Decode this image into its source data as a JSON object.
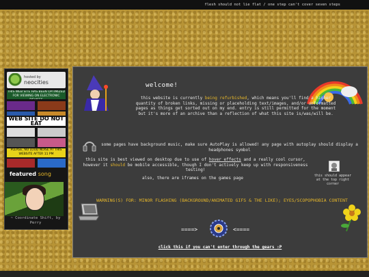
{
  "top_bar": {
    "tagline": "flesh should not lie flat / one step can't cover seven steps"
  },
  "sidebar": {
    "neocities": {
      "line1": "hosted by",
      "line2": "neocities"
    },
    "badges": [
      "THIS WEB SITE HAS BEEN OPTIMIZED FOR VIEWING ON ELECTRONIC DEVICES",
      "WEB SITE DO NOT EAT",
      "PLEASE, NO LOUD NOISE AT THIS WEBSITE AFTER 11 PM"
    ],
    "featured_label": "featured",
    "featured_song": "song",
    "song_caption": "~ Coordinate Shift, by Perry"
  },
  "main": {
    "welcome": "welcome!",
    "p1_before": "this website is currently ",
    "p1_highlight": "being refurbished",
    "p1_after": ", which means you'll find a higher quantity of broken links, missing or placeholding text/images, and/or unformatted pages as things get sorted out on my end. entry is still permitted for the moment but it's more of an archive than a reflection of what this site is/was/will be.",
    "p2": "some pages have background music, make sure AutoPlay is allowed! any page with autoplay should display a headphones symbol",
    "p3_before": "this site is best viewed on desktop due to use of ",
    "p3_link": "hover effects",
    "p3_middle": " and a really cool cursor, however it ",
    "p3_should": "should",
    "p3_after": " be mobile accessible, though I don't actively keep up with responsiveness testing!",
    "p4": "also, there are iframes on the games page",
    "side_note": "this should appear at the top right corner",
    "warning": "WARNING(S) FOR: MINOR FLASHING (BACKGROUND/ANIMATED GIFS & THE LIKE); EYES/SCOPOPHOBIA CONTENT",
    "arrow_left": "====>",
    "arrow_right": "<====",
    "enter_link": "click this if you can't enter through the gears :P"
  },
  "colors": {
    "accent": "#e8b82a",
    "panel": "#3c3c3c",
    "background": "#b89436"
  }
}
